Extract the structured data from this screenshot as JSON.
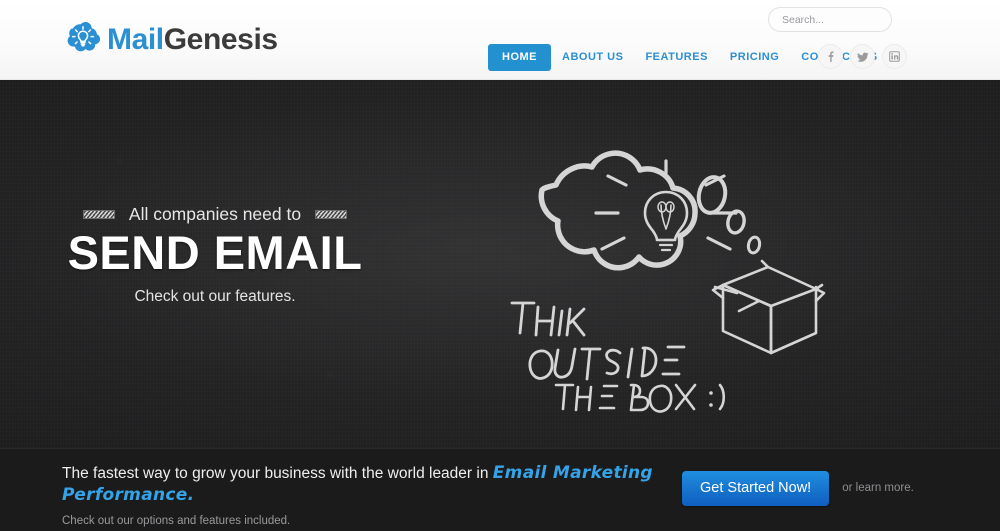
{
  "brand": {
    "name_part1": "Mail",
    "name_part2": "Genesis",
    "icon": "cloud-lightbulb-icon",
    "color_primary": "#2b8fd4",
    "color_dark": "#3b3b3b"
  },
  "search": {
    "placeholder": "Search...",
    "value": "",
    "icon": "search-icon"
  },
  "nav": {
    "items": [
      {
        "label": "HOME",
        "active": true
      },
      {
        "label": "ABOUT US",
        "active": false
      },
      {
        "label": "FEATURES",
        "active": false
      },
      {
        "label": "PRICING",
        "active": false
      },
      {
        "label": "CONTACT US",
        "active": false
      }
    ],
    "active_bg": "#2390cf",
    "link_color": "#2b8fd4"
  },
  "social": [
    {
      "name": "facebook-icon",
      "glyph": "f"
    },
    {
      "name": "twitter-icon",
      "glyph": "t"
    },
    {
      "name": "linkedin-icon",
      "glyph": "in"
    }
  ],
  "hero": {
    "kicker": "All companies need to",
    "title": "SEND EMAIL",
    "subtitle": "Check out our features.",
    "background": "chalkboard",
    "illustration": {
      "name": "think-outside-the-box-chalk-drawing",
      "elements": [
        "thought-bubble-cloud",
        "lightbulb",
        "bubble-dots",
        "open-cardboard-box"
      ],
      "handwriting": [
        "THINK",
        "OUTSIDE",
        "THE BOX :)"
      ]
    }
  },
  "bottom_bar": {
    "lead_plain": "The fastest way to grow your business with the world leader in ",
    "lead_accent": "Email Marketing Performance.",
    "accent_color": "#35a3e8",
    "small_text": "Check out our options and features included.",
    "cta_label": "Get Started Now!",
    "cta_note": "or learn more."
  }
}
